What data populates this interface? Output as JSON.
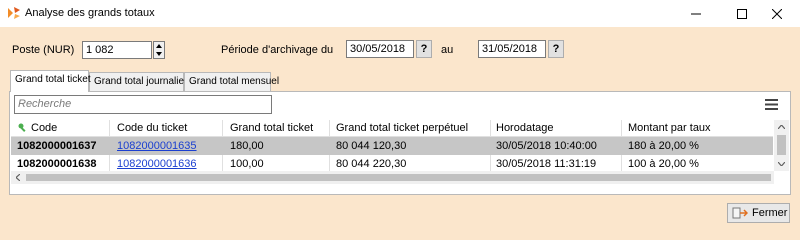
{
  "window": {
    "title": "Analyse des grands totaux",
    "icon": "app-logo-icon",
    "controls": [
      "minimize-icon",
      "maximize-icon",
      "close-icon"
    ]
  },
  "filters": {
    "poste_label": "Poste (NUR)",
    "poste_value": "1 082",
    "periode_label": "Période d'archivage du",
    "date_from": "30/05/2018",
    "date_from_help": "?",
    "au_label": "au",
    "date_to": "31/05/2018",
    "date_to_help": "?"
  },
  "tabs": [
    {
      "label": "Grand total ticket",
      "active": true
    },
    {
      "label": "Grand total journalier",
      "active": false
    },
    {
      "label": "Grand total mensuel",
      "active": false
    }
  ],
  "search": {
    "placeholder": "Recherche"
  },
  "table": {
    "columns": [
      "Code",
      "Code du ticket",
      "Grand total ticket",
      "Grand total ticket perpétuel",
      "Horodatage",
      "Montant par taux"
    ],
    "rows": [
      {
        "code": "1082000001637",
        "ticket": "1082000001635",
        "total": "180,00",
        "perpetuel": "80 044 120,30",
        "horodatage": "30/05/2018 10:40:00",
        "montant": "180 à 20,00 %",
        "selected": true
      },
      {
        "code": "1082000001638",
        "ticket": "1082000001636",
        "total": "100,00",
        "perpetuel": "80 044 220,30",
        "horodatage": "30/05/2018 11:31:19",
        "montant": "100 à 20,00 %",
        "selected": false
      }
    ]
  },
  "footer": {
    "close_label": "Fermer"
  },
  "colors": {
    "panel_bg": "#fbe6cc",
    "link": "#1b3fd0",
    "selected_row": "#c6c6c6"
  }
}
